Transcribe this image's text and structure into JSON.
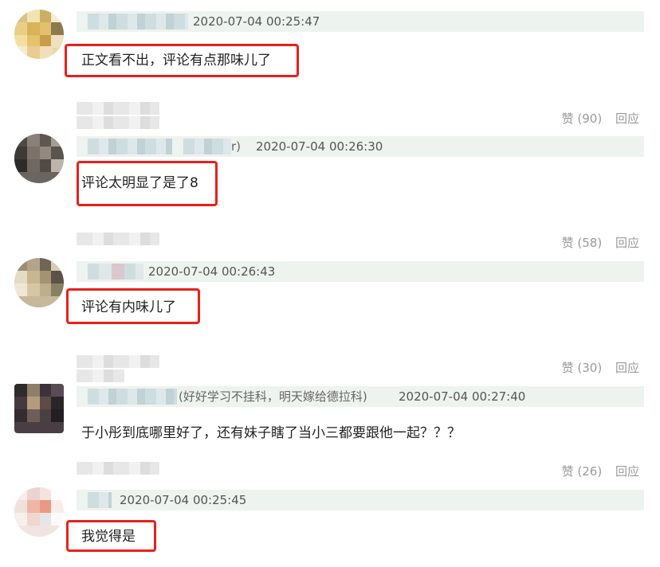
{
  "comments": [
    {
      "timestamp": "2020-07-04 00:25:47",
      "text": "正文看不出，评论有点那味儿了",
      "likes_label": "赞 (90)",
      "reply_label": "回应"
    },
    {
      "timestamp": "2020-07-04 00:26:30",
      "name_suffix": "r)",
      "text": "评论太明显了是了8",
      "likes_label": "赞 (58)",
      "reply_label": "回应"
    },
    {
      "timestamp": "2020-07-04 00:26:43",
      "text": "评论有内味儿了",
      "likes_label": "赞 (30)",
      "reply_label": "回应"
    },
    {
      "timestamp": "2020-07-04 00:27:40",
      "name_suffix": "(好好学习不挂科，明天嫁给德拉科)",
      "text": "于小彤到底哪里好了，还有妹子瞎了当小三都要跟他一起？？？",
      "likes_label": "赞 (26)",
      "reply_label": "回应"
    },
    {
      "timestamp": "2020-07-04 00:25:45",
      "text": "我觉得是"
    }
  ]
}
